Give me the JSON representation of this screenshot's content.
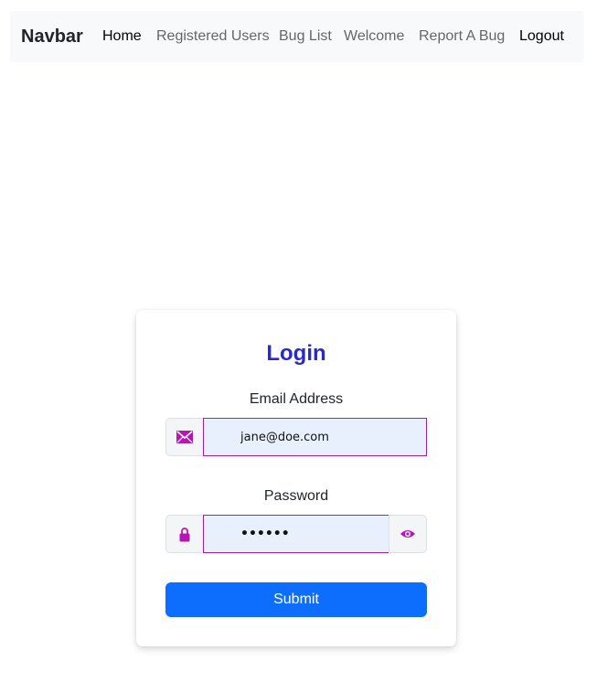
{
  "navbar": {
    "brand": "Navbar",
    "links": [
      "Home",
      "Registered Users",
      "Bug List",
      "Welcome",
      "Report A Bug"
    ],
    "logout": "Logout"
  },
  "login": {
    "title": "Login",
    "email_label": "Email Address",
    "email_value": "jane@doe.com",
    "password_label": "Password",
    "password_value": "••••••",
    "submit_label": "Submit"
  },
  "icons": {
    "email": "envelope-icon",
    "password": "lock-icon",
    "toggle": "eye-icon"
  },
  "colors": {
    "accent_icon": "#b516b5",
    "title": "#2b2bc4",
    "submit": "#0d6efd",
    "field_border": "#a31fa8"
  }
}
